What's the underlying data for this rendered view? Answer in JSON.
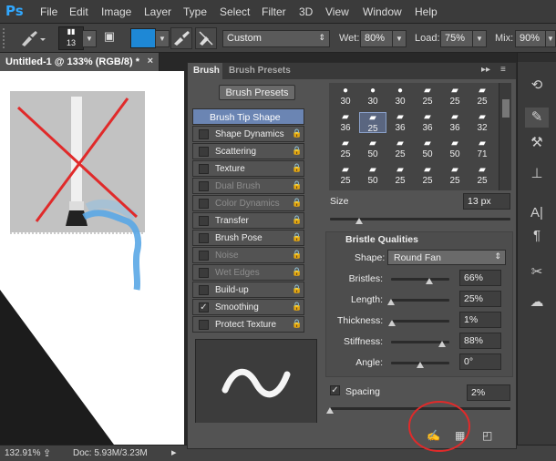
{
  "app": {
    "logo": "Ps"
  },
  "menu": [
    "File",
    "Edit",
    "Image",
    "Layer",
    "Type",
    "Select",
    "Filter",
    "3D",
    "View",
    "Window",
    "Help"
  ],
  "options": {
    "brush_size": "13",
    "preset": "Custom",
    "wet_label": "Wet:",
    "wet_value": "80%",
    "load_label": "Load:",
    "load_value": "75%",
    "mix_label": "Mix:",
    "mix_value": "90%",
    "swatch_color": "#1e88d6"
  },
  "document": {
    "tab_title": "Untitled-1 @ 133% (RGB/8) *"
  },
  "status": {
    "zoom": "132.91%",
    "doc": "Doc: 5.93M/3.23M"
  },
  "panel": {
    "tabs": [
      "Brush",
      "Brush Presets"
    ],
    "brush_presets_button": "Brush Presets",
    "list": [
      {
        "label": "Brush Tip Shape",
        "state": "selected"
      },
      {
        "label": "Shape Dynamics",
        "state": "off"
      },
      {
        "label": "Scattering",
        "state": "off"
      },
      {
        "label": "Texture",
        "state": "off"
      },
      {
        "label": "Dual Brush",
        "state": "disabled"
      },
      {
        "label": "Color Dynamics",
        "state": "disabled"
      },
      {
        "label": "Transfer",
        "state": "off"
      },
      {
        "label": "Brush Pose",
        "state": "off"
      },
      {
        "label": "Noise",
        "state": "disabled"
      },
      {
        "label": "Wet Edges",
        "state": "disabled"
      },
      {
        "label": "Build-up",
        "state": "off"
      },
      {
        "label": "Smoothing",
        "state": "checked"
      },
      {
        "label": "Protect Texture",
        "state": "off"
      }
    ],
    "grid": [
      [
        "30",
        "30",
        "30",
        "25",
        "25",
        "25"
      ],
      [
        "36",
        "25",
        "36",
        "36",
        "36",
        "32"
      ],
      [
        "25",
        "50",
        "25",
        "50",
        "50",
        "71"
      ],
      [
        "25",
        "50",
        "25",
        "25",
        "25",
        "25"
      ]
    ],
    "size_label": "Size",
    "size_value": "13 px",
    "size_level": 0.05,
    "bristle": {
      "title": "Bristle Qualities",
      "shape_label": "Shape:",
      "shape_value": "Round Fan",
      "rows": [
        {
          "label": "Bristles:",
          "value": "66%",
          "level": 0.66
        },
        {
          "label": "Length:",
          "value": "25%",
          "level": 0.0
        },
        {
          "label": "Thickness:",
          "value": "1%",
          "level": 0.01
        },
        {
          "label": "Stiffness:",
          "value": "88%",
          "level": 0.88
        },
        {
          "label": "Angle:",
          "value": "0°",
          "level": 0.5
        }
      ]
    },
    "spacing_label": "Spacing",
    "spacing_value": "2%",
    "spacing_level": 0.0
  }
}
